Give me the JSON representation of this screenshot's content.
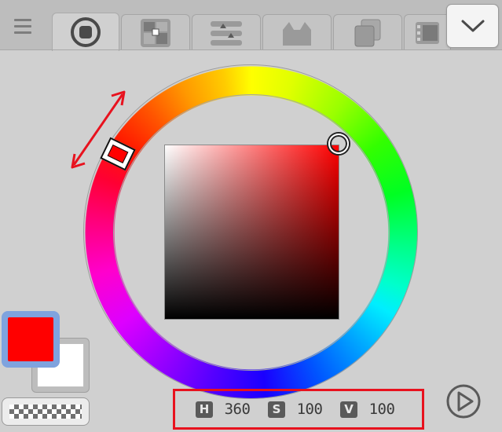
{
  "tabs": [
    {
      "name": "tab-color-wheel",
      "icon": "color-wheel-icon",
      "active": true
    },
    {
      "name": "tab-intermediate-color",
      "icon": "intermediate-color-icon",
      "active": false
    },
    {
      "name": "tab-color-slider",
      "icon": "color-slider-icon",
      "active": false
    },
    {
      "name": "tab-color-set",
      "icon": "color-set-icon",
      "active": false
    },
    {
      "name": "tab-approximate-color",
      "icon": "approximate-color-icon",
      "active": false
    },
    {
      "name": "tab-color-history",
      "icon": "color-history-icon",
      "active": false
    }
  ],
  "colors": {
    "hue_color": "#ff0000",
    "main_color": "#ff0000",
    "sub_color": "#ffffff",
    "annotation": "#e8121e",
    "fg_highlight": "#7fa3de"
  },
  "hsv": {
    "h_label": "H",
    "h_value": "360",
    "s_label": "S",
    "s_value": "100",
    "v_label": "V",
    "v_value": "100"
  },
  "icons": {
    "menu": "hamburger-menu-icon",
    "dropdown": "chevron-down-icon",
    "play": "play-circle-icon",
    "drag_hint": "double-arrow-icon"
  }
}
